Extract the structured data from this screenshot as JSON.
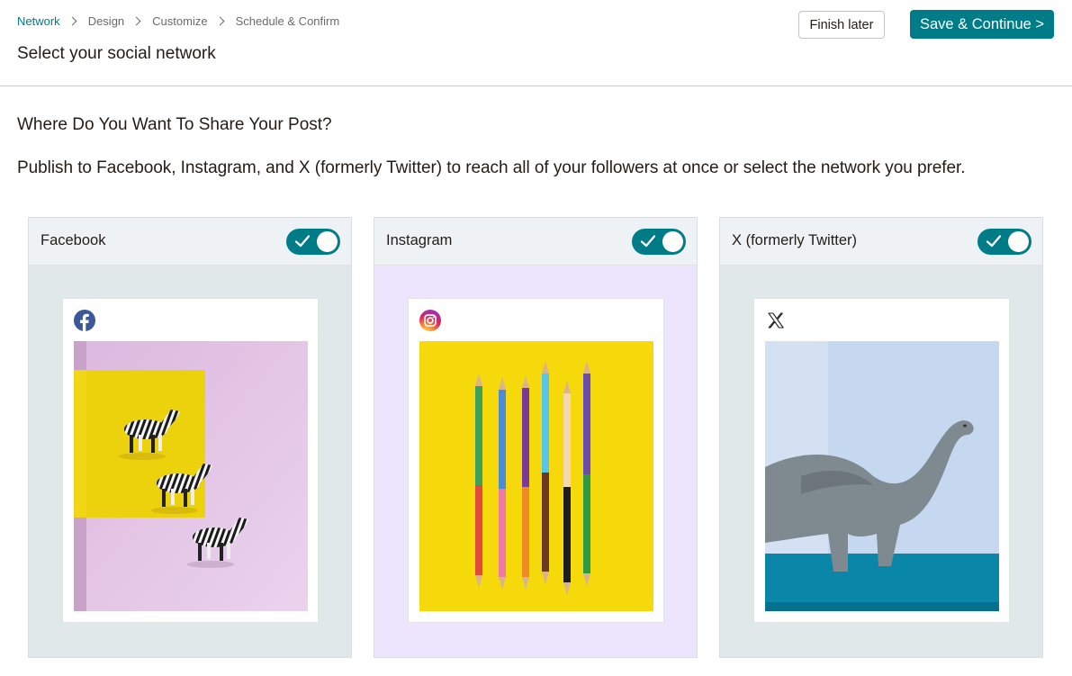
{
  "breadcrumb": [
    "Network",
    "Design",
    "Customize",
    "Schedule & Confirm"
  ],
  "page_title": "Select your social network",
  "actions": {
    "finish_later": "Finish later",
    "save_continue": "Save & Continue >"
  },
  "question": "Where Do You Want To Share Your Post?",
  "description": "Publish to Facebook, Instagram, and X (formerly Twitter) to reach all of your followers at once or select the network you prefer.",
  "colors": {
    "accent": "#007c89",
    "facebook_body": "#e1e8ea",
    "instagram_body": "#ede5fd",
    "x_body": "#e1e8ea"
  },
  "networks": [
    {
      "name": "Facebook",
      "enabled": true,
      "icon": "facebook-icon",
      "photo": "zebra-figurines-on-yellow-and-pink"
    },
    {
      "name": "Instagram",
      "enabled": true,
      "icon": "instagram-icon",
      "photo": "colored-pencils-on-yellow"
    },
    {
      "name": "X (formerly Twitter)",
      "enabled": true,
      "icon": "x-icon",
      "photo": "toy-dinosaur-on-blue"
    }
  ]
}
